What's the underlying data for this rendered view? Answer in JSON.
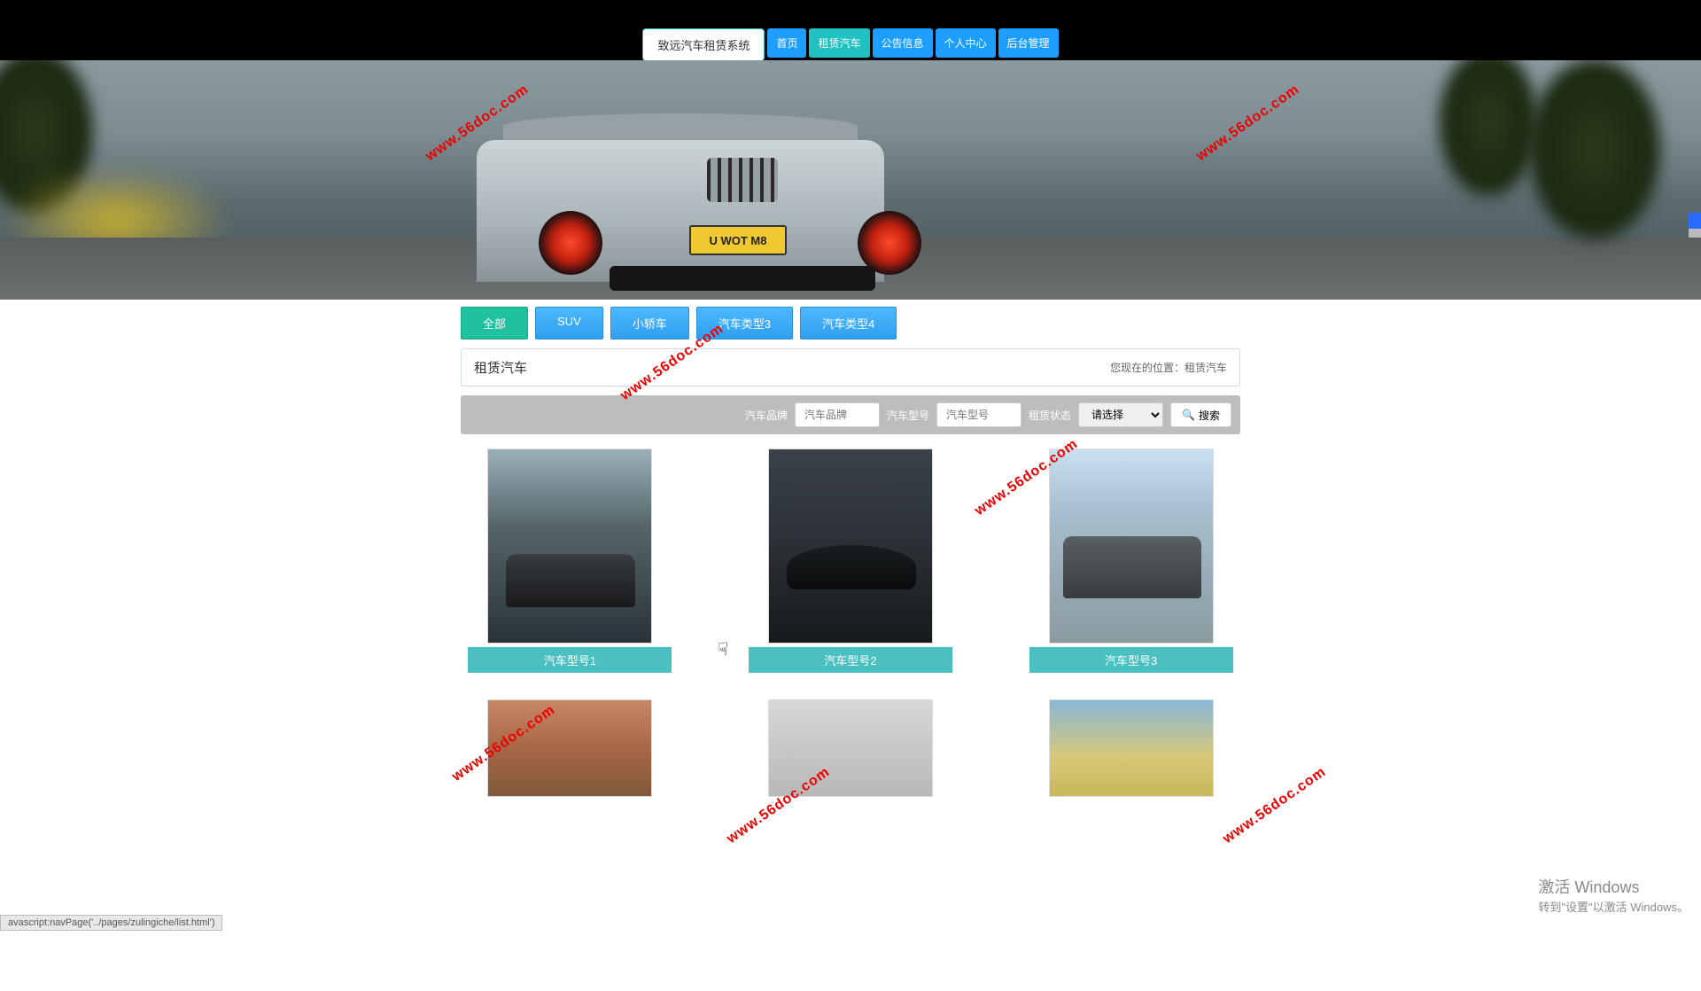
{
  "nav": {
    "brand": "致远汽车租赁系统",
    "items": [
      "首页",
      "租赁汽车",
      "公告信息",
      "个人中心",
      "后台管理"
    ],
    "active_index": 1
  },
  "hero": {
    "plate": "U WOT M8"
  },
  "filters": {
    "tabs": [
      "全部",
      "SUV",
      "小轿车",
      "汽车类型3",
      "汽车类型4"
    ],
    "active_index": 0
  },
  "title_bar": {
    "title": "租赁汽车",
    "location_label": "您现在的位置：",
    "location_value": "租赁汽车"
  },
  "search": {
    "brand_label": "汽车品牌",
    "brand_placeholder": "汽车品牌",
    "model_label": "汽车型号",
    "model_placeholder": "汽车型号",
    "status_label": "租赁状态",
    "status_placeholder": "请选择",
    "button": "搜索"
  },
  "cards": [
    {
      "label": "汽车型号1"
    },
    {
      "label": "汽车型号2"
    },
    {
      "label": "汽车型号3"
    },
    {
      "label": ""
    },
    {
      "label": ""
    },
    {
      "label": ""
    }
  ],
  "watermark_text": "www.56doc.com",
  "windows": {
    "title": "激活 Windows",
    "sub": "转到\"设置\"以激活 Windows。"
  },
  "status_text": "avascript:navPage('../pages/zulingiche/list.html')"
}
